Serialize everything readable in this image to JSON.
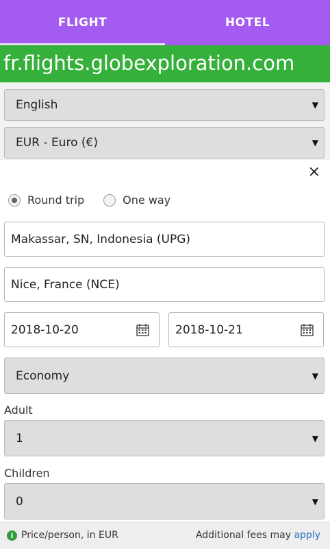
{
  "tabs": [
    {
      "label": "FLIGHT",
      "active": true
    },
    {
      "label": "HOTEL",
      "active": false
    }
  ],
  "domain": "fr.flights.globexploration.com",
  "language": {
    "value": "English"
  },
  "currency": {
    "value": "EUR - Euro (€)"
  },
  "close_symbol": "×",
  "trip_type": {
    "options": [
      {
        "label": "Round trip",
        "checked": true
      },
      {
        "label": "One way",
        "checked": false
      }
    ]
  },
  "origin": {
    "value": "Makassar, SN, Indonesia (UPG)"
  },
  "destination": {
    "value": "Nice, France (NCE)"
  },
  "depart_date": {
    "value": "2018-10-20"
  },
  "return_date": {
    "value": "2018-10-21"
  },
  "cabin_class": {
    "value": "Economy"
  },
  "adult": {
    "label": "Adult",
    "value": "1"
  },
  "children": {
    "label": "Children",
    "value": "0"
  },
  "footer": {
    "price_note": "Price/person, in EUR",
    "fees_text": "Additional fees may",
    "fees_link": "apply"
  },
  "colors": {
    "tab_bar": "#a35bf0",
    "domain_bar": "#35b03a",
    "link": "#1e6fc2",
    "info_icon": "#2e9b3c"
  },
  "icons": [
    "calendar-icon",
    "close-icon",
    "info-icon",
    "caret-down-icon"
  ]
}
